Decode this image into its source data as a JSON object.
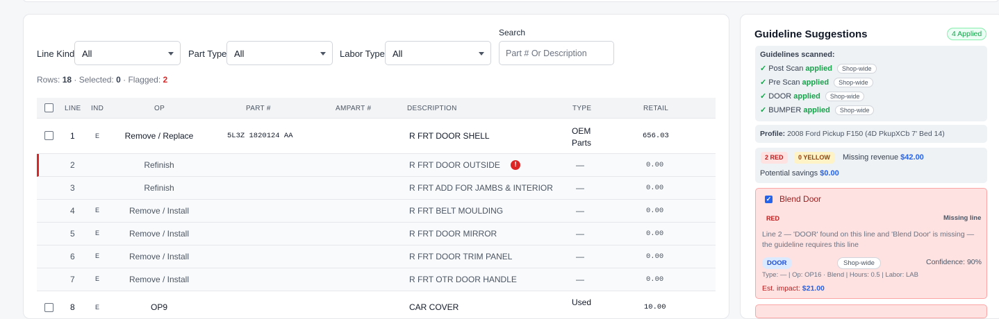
{
  "filters": {
    "line_kind_label": "Line Kind",
    "line_kind_value": "All",
    "part_type_label": "Part Type",
    "part_type_value": "All",
    "labor_type_label": "Labor Type",
    "labor_type_value": "All",
    "search_label": "Search",
    "search_placeholder": "Part # Or Description"
  },
  "stats": {
    "rows_label": "Rows:",
    "rows": "18",
    "selected_label": "· Selected:",
    "selected": "0",
    "flagged_label": "· Flagged:",
    "flagged": "2"
  },
  "columns": [
    "LINE",
    "IND",
    "OP",
    "PART #",
    "AMPART #",
    "DESCRIPTION",
    "TYPE",
    "RETAIL"
  ],
  "rows": [
    {
      "line": "1",
      "ind": "E",
      "op": "Remove / Replace",
      "part": "5L3Z 1820124 AA",
      "desc": "R FRT DOOR SHELL",
      "type": "OEM Parts",
      "retail": "656.03"
    },
    {
      "line": "2",
      "ind": "",
      "op": "Refinish",
      "part": "",
      "desc": "R FRT DOOR OUTSIDE",
      "type": "—",
      "retail": "0.00"
    },
    {
      "line": "3",
      "ind": "",
      "op": "Refinish",
      "part": "",
      "desc": "R FRT ADD FOR JAMBS & INTERIOR",
      "type": "—",
      "retail": "0.00"
    },
    {
      "line": "4",
      "ind": "E",
      "op": "Remove / Install",
      "part": "",
      "desc": "R FRT BELT MOULDING",
      "type": "—",
      "retail": "0.00"
    },
    {
      "line": "5",
      "ind": "E",
      "op": "Remove / Install",
      "part": "",
      "desc": "R FRT DOOR MIRROR",
      "type": "—",
      "retail": "0.00"
    },
    {
      "line": "6",
      "ind": "E",
      "op": "Remove / Install",
      "part": "",
      "desc": "R FRT DOOR TRIM PANEL",
      "type": "—",
      "retail": "0.00"
    },
    {
      "line": "7",
      "ind": "E",
      "op": "Remove / Install",
      "part": "",
      "desc": "R FRT OTR DOOR HANDLE",
      "type": "—",
      "retail": "0.00"
    },
    {
      "line": "8",
      "ind": "E",
      "op": "OP9",
      "part": "",
      "desc": "CAR COVER",
      "type": "Used",
      "retail": "10.00"
    }
  ],
  "error_glyph": "!",
  "panel": {
    "title": "Guideline Suggestions",
    "applied": "4 Applied",
    "scan_title": "Guidelines scanned:",
    "scans": [
      {
        "name": "Post Scan",
        "status": "applied",
        "scope": "Shop-wide"
      },
      {
        "name": "Pre Scan",
        "status": "applied",
        "scope": "Shop-wide"
      },
      {
        "name": "DOOR",
        "status": "applied",
        "scope": "Shop-wide"
      },
      {
        "name": "BUMPER",
        "status": "applied",
        "scope": "Shop-wide"
      }
    ],
    "check": "✓",
    "profile_label": "Profile:",
    "profile": "2008 Ford Pickup F150 (4D PkupXCb 7' Bed 14)",
    "red_badge": "2 RED",
    "yellow_badge": "0 YELLOW",
    "missing_revenue_label": "Missing revenue",
    "missing_revenue": "$42.00",
    "savings_label": "Potential savings",
    "savings": "$0.00",
    "suggestion": {
      "title": "Blend Door",
      "severity": "RED",
      "kind": "Missing line",
      "body": "Line 2 — 'DOOR' found on this line and 'Blend Door' is missing — the guideline requires this line",
      "tag": "DOOR",
      "scope": "Shop-wide",
      "confidence": "Confidence: 90%",
      "meta": "Type: — | Op: OP16 · Blend | Hours: 0.5 | Labor: LAB",
      "impact_label": "Est. impact:",
      "impact": "$21.00"
    }
  },
  "colors": {
    "accent": "#2563eb",
    "danger": "#dc2626",
    "success": "#16a34a"
  }
}
